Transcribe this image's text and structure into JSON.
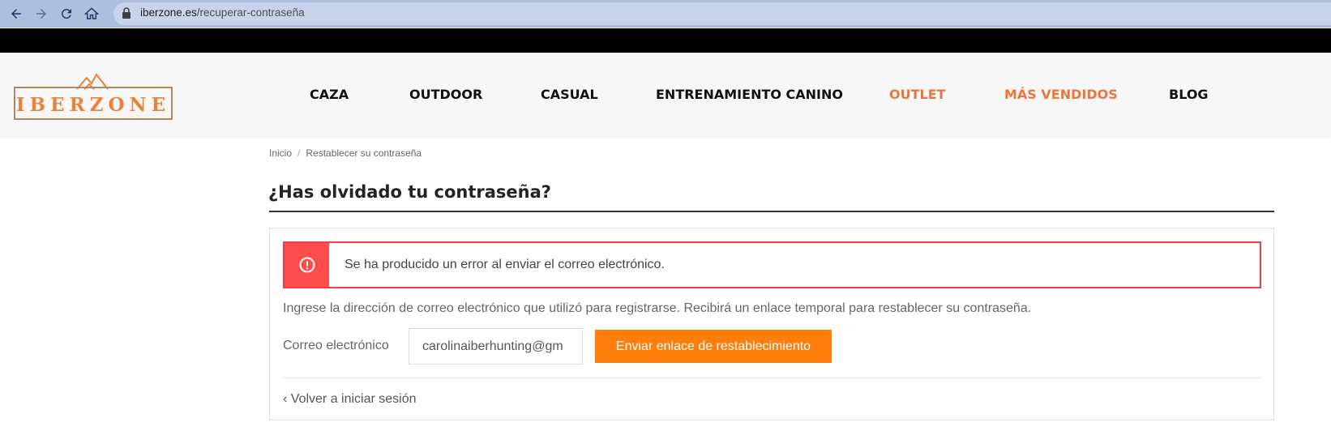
{
  "browser": {
    "url_host": "iberzone.es",
    "url_path": "/recuperar-contraseña",
    "icons": [
      "back-arrow-icon",
      "forward-arrow-icon",
      "reload-icon",
      "home-icon",
      "lock-icon"
    ]
  },
  "header": {
    "logo_text": "IBERZONE",
    "nav": [
      {
        "label": "CAZA",
        "highlight": false
      },
      {
        "label": "OUTDOOR",
        "highlight": false
      },
      {
        "label": "CASUAL",
        "highlight": false
      },
      {
        "label": "ENTRENAMIENTO CANINO",
        "highlight": false
      },
      {
        "label": "OUTLET",
        "highlight": true
      },
      {
        "label": "MÁS VENDIDOS",
        "highlight": true
      },
      {
        "label": "BLOG",
        "highlight": false
      }
    ],
    "accent_color": "#e8773d"
  },
  "breadcrumb": {
    "items": [
      "Inicio",
      "Restablecer su contraseña"
    ],
    "separator": "/"
  },
  "page": {
    "title": "¿Has olvidado tu contraseña?"
  },
  "alert": {
    "icon": "alert-circle-icon",
    "message": "Se ha producido un error al enviar el correo electrónico.",
    "color": "#ff4c4c"
  },
  "form": {
    "instructions": "Ingrese la dirección de correo electrónico que utilizó para registrarse. Recibirá un enlace temporal para restablecer su contraseña.",
    "email_label": "Correo electrónico",
    "email_value": "carolinaiberhunting@gm",
    "submit_label": "Enviar enlace de restablecimiento",
    "submit_color": "#ff7e0b",
    "back_label": "‹ Volver a iniciar sesión"
  }
}
